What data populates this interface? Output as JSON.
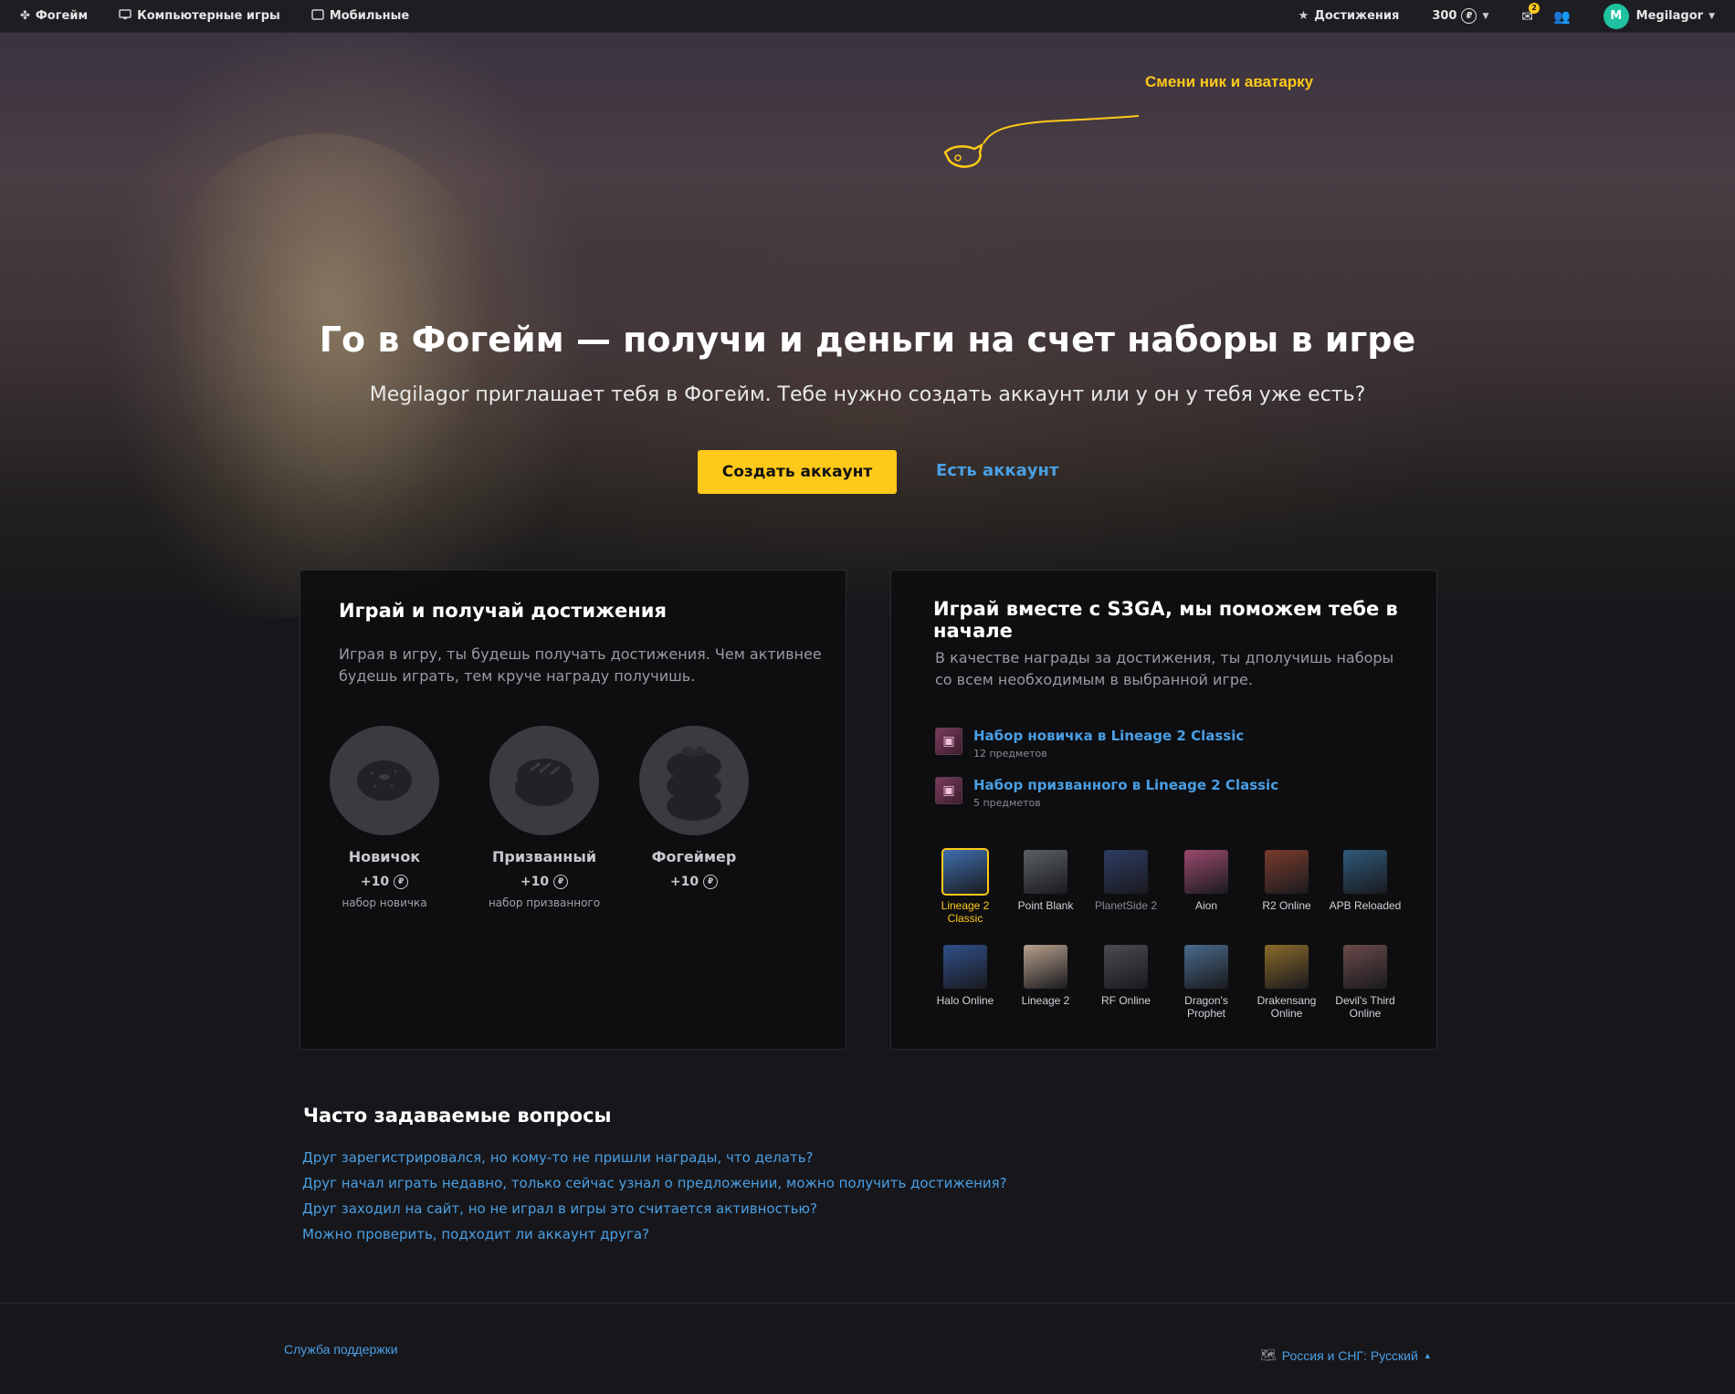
{
  "nav": {
    "brand": "Фогейм",
    "pc_games": "Компьютерные игры",
    "mobile": "Мобильные",
    "achievements": "Достижения",
    "balance": "300",
    "currency_symbol": "₽",
    "mail_count": "2",
    "user_initial": "M",
    "username": "Megilagor"
  },
  "hero": {
    "hint": "Смени ник и аватарку",
    "title": "Го в Фогейм — получи и деньги на счет наборы в игре",
    "subtitle": "Megilagor приглашает тебя в Фогейм. Тебе нужно создать аккаунт или у он у тебя уже есть?",
    "create_button": "Создать аккаунт",
    "login_link": "Есть аккаунт"
  },
  "achievements_card": {
    "title": "Играй и получай достижения",
    "description_line1": "Играя в игру, ты будешь получать достижения. Чем активнее",
    "description_line2": "будешь играть, тем круче награду получишь.",
    "items": [
      {
        "name": "Новичок",
        "reward": "+10",
        "note": "набор новичка",
        "icon": "donut-icon"
      },
      {
        "name": "Призванный",
        "reward": "+10",
        "note": "набор призванного",
        "icon": "glazed-donut-icon"
      },
      {
        "name": "Фогеймер",
        "reward": "+10",
        "note": "",
        "icon": "donut-stack-icon"
      }
    ]
  },
  "s3ga_card": {
    "title": "Играй вместе с S3GA, мы поможем тебе в начале",
    "description_line1": "В качестве награды за достижения, ты дполучишь наборы",
    "description_line2": "со всем необходимым в выбранной игре.",
    "kits": [
      {
        "title": "Набор новичка в Lineage 2 Classic",
        "count": "12 предметов"
      },
      {
        "title": "Набор призванного в Lineage 2 Classic",
        "count": "5 предметов"
      }
    ],
    "games": [
      {
        "label": "Lineage 2 Classic",
        "color": "#3f6fb0",
        "state": "selected"
      },
      {
        "label": "Point Blank",
        "color": "#5b6066",
        "state": "normal"
      },
      {
        "label": "PlanetSide 2",
        "color": "#2e3c63",
        "state": "dim"
      },
      {
        "label": "Aion",
        "color": "#9b4a6e",
        "state": "normal"
      },
      {
        "label": "R2 Online",
        "color": "#7a3c2c",
        "state": "normal"
      },
      {
        "label": "APB Reloaded",
        "color": "#2f5a7a",
        "state": "normal"
      },
      {
        "label": "Halo Online",
        "color": "#2f4f8a",
        "state": "normal"
      },
      {
        "label": "Lineage 2",
        "color": "#b8a08c",
        "state": "normal"
      },
      {
        "label": "RF Online",
        "color": "#4a4a52",
        "state": "normal"
      },
      {
        "label": "Dragon's Prophet",
        "color": "#4a6a8a",
        "state": "normal"
      },
      {
        "label": "Drakensang Online",
        "color": "#8a6a2a",
        "state": "normal"
      },
      {
        "label": "Devil's Third Online",
        "color": "#6a4a4a",
        "state": "normal"
      }
    ]
  },
  "faq": {
    "title": "Часто задаваемые вопросы",
    "items": [
      "Друг зарегистрировался, но кому-то не пришли награды, что делать?",
      "Друг начал играть недавно, только сейчас узнал о предложении, можно получить достижения?",
      "Друг заходил на сайт, но не играл в игры это считается активностью?",
      "Можно проверить, подходит ли аккаунт друга?"
    ]
  },
  "footer": {
    "support": "Служба поддержки",
    "region": "Россия и СНГ: Русский"
  },
  "colors": {
    "accent": "#ffc91a",
    "link": "#4a9fe4",
    "background": "#17171b",
    "avatar": "#1fc1a0"
  }
}
